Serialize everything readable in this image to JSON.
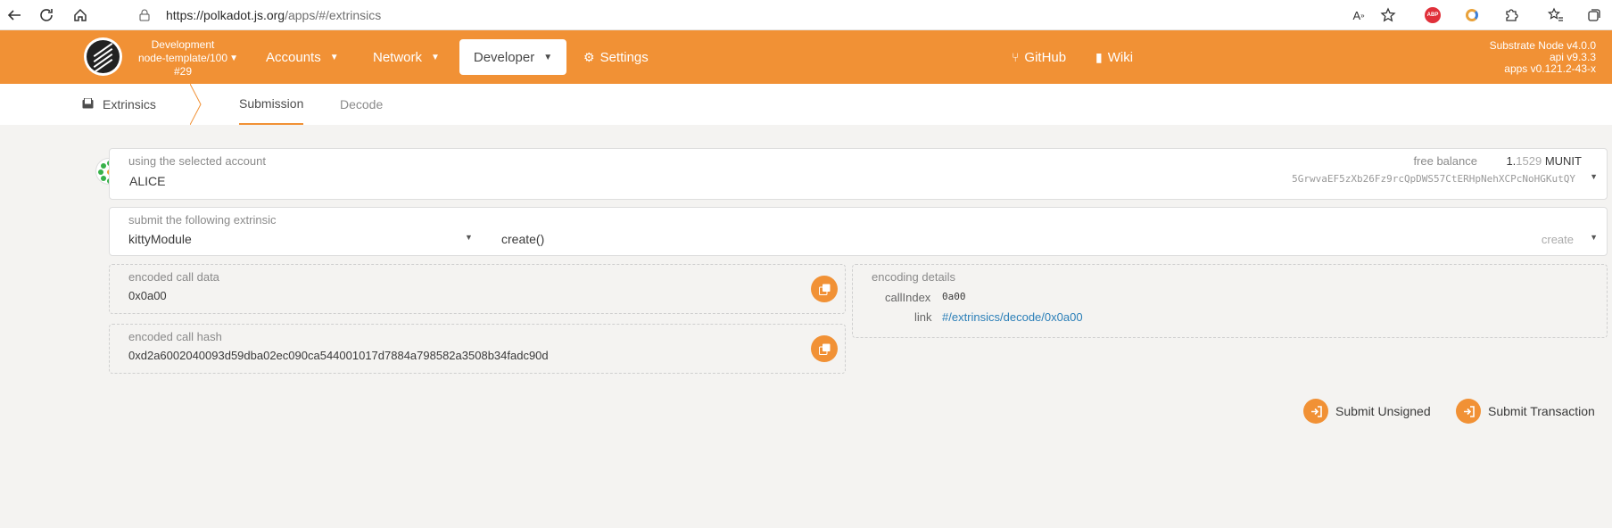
{
  "browser": {
    "url_host": "https://polkadot.js.org",
    "url_path": "/apps/#/extrinsics",
    "icons": [
      "back-icon",
      "reload-icon",
      "home-icon",
      "lock-icon",
      "read-aloud-icon",
      "favorite-add-icon",
      "adblock-icon",
      "extension-icon",
      "puzzle-icon",
      "favorites-icon",
      "collections-icon"
    ],
    "abp_label": "ABP"
  },
  "header": {
    "chain_name": "Development",
    "chain_node": "node-template/100",
    "chain_block": "#29",
    "nav": [
      "Accounts",
      "Network",
      "Developer",
      "Settings"
    ],
    "github": "GitHub",
    "wiki": "Wiki",
    "version": [
      "Substrate Node v4.0.0",
      "api v9.3.3",
      "apps v0.121.2-43-x"
    ],
    "accent_color": "#f19135"
  },
  "subnav": {
    "section": "Extrinsics",
    "tabs": [
      "Submission",
      "Decode"
    ],
    "active_tab": "Submission"
  },
  "account": {
    "label": "using the selected account",
    "name": "ALICE",
    "balance_label": "free balance",
    "balance_int": "1.",
    "balance_dec": "1529",
    "balance_unit": "MUNIT",
    "address": "5GrwvaEF5zXb26Fz9rcQpDWS57CtERHpNehXCPcNoHGKutQY"
  },
  "extrinsic": {
    "label": "submit the following extrinsic",
    "module": "kittyModule",
    "call": "create()",
    "method": "create"
  },
  "encoded_data": {
    "label": "encoded call data",
    "value": "0x0a00"
  },
  "encoded_hash": {
    "label": "encoded call hash",
    "value": "0xd2a6002040093d59dba02ec090ca544001017d7884a798582a3508b34fadc90d"
  },
  "encoding_details": {
    "label": "encoding details",
    "callindex_label": "callIndex",
    "callindex_value": "0a00",
    "link_label": "link",
    "link_value": "#/extrinsics/decode/0x0a00"
  },
  "actions": {
    "unsigned": "Submit Unsigned",
    "transaction": "Submit Transaction"
  }
}
